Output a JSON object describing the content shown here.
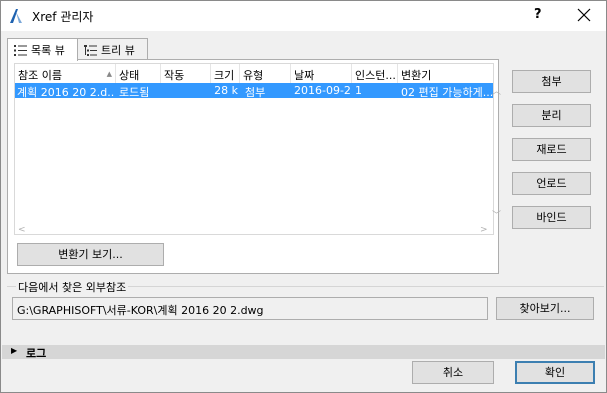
{
  "window": {
    "title": "Xref 관리자",
    "help": "?",
    "accent_color": "#3399ff"
  },
  "tabs": [
    {
      "label": "목록 뷰",
      "active": true,
      "icon": "list-icon"
    },
    {
      "label": "트리 뷰",
      "active": false,
      "icon": "tree-icon"
    }
  ],
  "table": {
    "columns": [
      "참조 이름",
      "상태",
      "작동",
      "크기",
      "유형",
      "날짜",
      "인스턴...",
      "변환기"
    ],
    "rows": [
      [
        "계획 2016 20 2.d...",
        "로드됨",
        "",
        "28 k",
        "첨부",
        "2016-09-2...",
        "1",
        "02 편집 가능하게..."
      ]
    ]
  },
  "side_buttons": [
    "첨부",
    "분리",
    "재로드",
    "언로드",
    "바인드"
  ],
  "translator_button": "변환기 보기...",
  "found_in": {
    "label": "다음에서 찾은 외부참조",
    "path": "G:\\GRAPHISOFT\\서류-KOR\\계획 2016 20 2.dwg",
    "browse_button": "찾아보기..."
  },
  "log": {
    "label": "로그"
  },
  "footer": {
    "cancel": "취소",
    "ok": "확인"
  }
}
